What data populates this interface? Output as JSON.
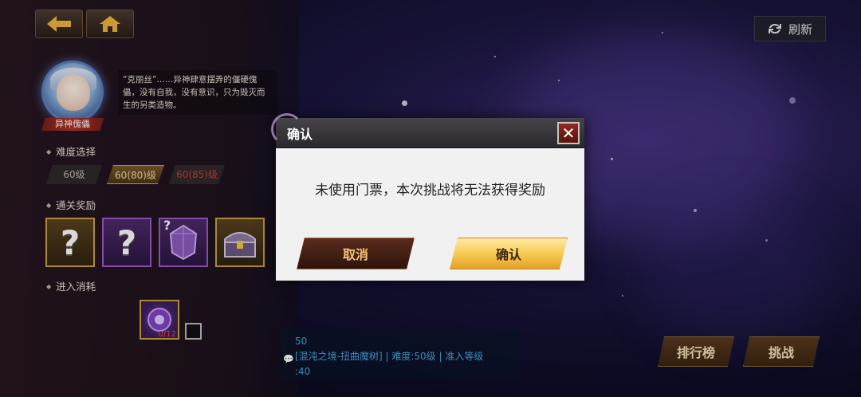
{
  "nav": {
    "back_icon": "arrow-left-icon",
    "home_icon": "home-icon"
  },
  "boss": {
    "name": "异神傀儡",
    "description": "“克丽丝”……异神肆意摆弄的僵硬傀儡，没有自我，没有意识，只为毁灭而生的另类造物。"
  },
  "difficulty": {
    "title": "难度选择",
    "options": [
      {
        "label": "60级"
      },
      {
        "label": "60(80)级"
      },
      {
        "label": "60(85)级"
      }
    ]
  },
  "rewards": {
    "title": "通关奖励",
    "items": [
      {
        "icon": "question-mark-icon"
      },
      {
        "icon": "question-mark-icon"
      },
      {
        "icon": "gem-icon"
      },
      {
        "icon": "treasure-chest-icon"
      }
    ]
  },
  "cost": {
    "title": "进入消耗",
    "count": "0/12"
  },
  "refresh_label": "刷新",
  "chat": {
    "line1": "50",
    "line2": "[混沌之境-扭曲魔树] | 难度:50级 | 准入等级",
    "line3": ":40"
  },
  "buttons": {
    "ranking": "排行榜",
    "challenge": "挑战"
  },
  "dialog": {
    "title": "确认",
    "message": "未使用门票，本次挑战将无法获得奖励",
    "cancel": "取消",
    "confirm": "确认"
  },
  "colors": {
    "accent_gold": "#f6c74c",
    "dialog_bg": "#f1f1f1",
    "warning_red": "#ff3b3b"
  }
}
